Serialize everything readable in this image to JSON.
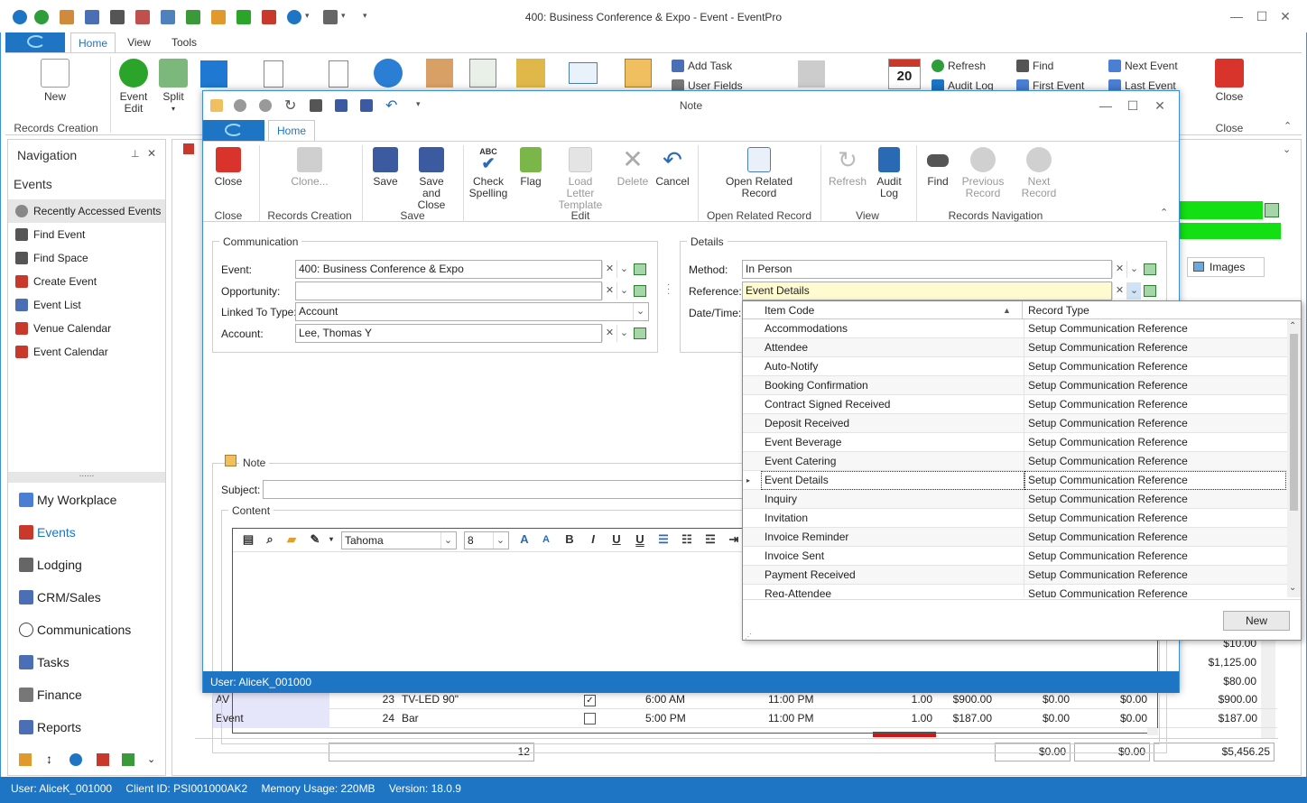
{
  "window": {
    "title": "400: Business Conference & Expo - Event - EventPro",
    "tabs": [
      "Home",
      "View",
      "Tools"
    ]
  },
  "ribbon": {
    "new_label": "New",
    "event_edit_label": "Event\nEdit",
    "split_label": "Split",
    "records_creation_label": "Records Creation",
    "add_task": "Add Task",
    "user_fields": "User Fields",
    "refresh": "Refresh",
    "audit_log": "Audit Log",
    "find": "Find",
    "first_event": "First Event",
    "next_event": "Next Event",
    "last_event": "Last Event",
    "close_label": "Close",
    "close_group": "Close",
    "calendar_day": "20"
  },
  "nav": {
    "header": "Navigation",
    "section": "Events",
    "items": [
      "Recently Accessed Events",
      "Find Event",
      "Find Space",
      "Create Event",
      "Event List",
      "Venue Calendar",
      "Event Calendar"
    ],
    "modules": [
      "My Workplace",
      "Events",
      "Lodging",
      "CRM/Sales",
      "Communications",
      "Tasks",
      "Finance",
      "Reports"
    ],
    "splitter": "......"
  },
  "background": {
    "images_tab": "Images",
    "right_values": [
      "$10.00",
      "$1,125.00",
      "$80.00"
    ],
    "rows": [
      {
        "type": "AV",
        "num": "23",
        "desc": "TV-LED 90\"",
        "checked": "✓",
        "start": "6:00 AM",
        "end": "11:00 PM",
        "qty": "1.00",
        "price": "$900.00",
        "c1": "$0.00",
        "c2": "$0.00",
        "total": "$900.00"
      },
      {
        "type": "Event",
        "num": "24",
        "desc": "Bar",
        "checked": "",
        "start": "5:00 PM",
        "end": "11:00 PM",
        "qty": "1.00",
        "price": "$187.00",
        "c1": "$0.00",
        "c2": "$0.00",
        "total": "$187.00"
      }
    ],
    "footer_count": "12",
    "footer_c1": "$0.00",
    "footer_c2": "$0.00",
    "footer_total": "$5,456.25"
  },
  "status": {
    "user": "User: AliceK_001000",
    "client": "Client ID: PSI001000AK2",
    "memory": "Memory Usage: 220MB",
    "version": "Version: 18.0.9"
  },
  "dialog": {
    "title": "Note",
    "tab": "Home",
    "buttons": {
      "close": "Close",
      "clone": "Clone...",
      "save": "Save",
      "save_close": "Save and\nClose",
      "check_spelling": "Check\nSpelling",
      "flag": "Flag",
      "load_letter": "Load Letter\nTemplate",
      "delete": "Delete",
      "cancel": "Cancel",
      "open_related": "Open Related\nRecord",
      "refresh": "Refresh",
      "audit_log": "Audit\nLog",
      "find": "Find",
      "previous": "Previous\nRecord",
      "next": "Next Record",
      "abc": "ABC"
    },
    "groups": {
      "close": "Close",
      "records_creation": "Records Creation",
      "save": "Save",
      "edit": "Edit",
      "open_related": "Open Related Record",
      "view": "View",
      "records_navigation": "Records Navigation"
    },
    "communication": {
      "title": "Communication",
      "event_label": "Event:",
      "event_value": "400: Business Conference & Expo",
      "opportunity_label": "Opportunity:",
      "opportunity_value": "",
      "linked_label": "Linked To Type:",
      "linked_value": "Account",
      "account_label": "Account:",
      "account_value": "Lee, Thomas Y"
    },
    "details": {
      "title": "Details",
      "method_label": "Method:",
      "method_value": "In Person",
      "reference_label": "Reference:",
      "reference_value": "Event Details",
      "datetime_label": "Date/Time:"
    },
    "note": {
      "title": "Note",
      "subject_label": "Subject:",
      "subject_value": "",
      "content_label": "Content",
      "font": "Tahoma",
      "size": "8"
    },
    "status": "User: AliceK_001000"
  },
  "dropdown": {
    "col1": "Item Code",
    "col2": "Record Type",
    "rows": [
      [
        "Accommodations",
        "Setup Communication Reference"
      ],
      [
        "Attendee",
        "Setup Communication Reference"
      ],
      [
        "Auto-Notify",
        "Setup Communication Reference"
      ],
      [
        "Booking Confirmation",
        "Setup Communication Reference"
      ],
      [
        "Contract Signed Received",
        "Setup Communication Reference"
      ],
      [
        "Deposit Received",
        "Setup Communication Reference"
      ],
      [
        "Event Beverage",
        "Setup Communication Reference"
      ],
      [
        "Event Catering",
        "Setup Communication Reference"
      ],
      [
        "Event Details",
        "Setup Communication Reference"
      ],
      [
        "Inquiry",
        "Setup Communication Reference"
      ],
      [
        "Invitation",
        "Setup Communication Reference"
      ],
      [
        "Invoice Reminder",
        "Setup Communication Reference"
      ],
      [
        "Invoice Sent",
        "Setup Communication Reference"
      ],
      [
        "Payment Received",
        "Setup Communication Reference"
      ],
      [
        "Reg-Attendee",
        "Setup Communication Reference"
      ]
    ],
    "selected_index": 8,
    "new_button": "New"
  }
}
